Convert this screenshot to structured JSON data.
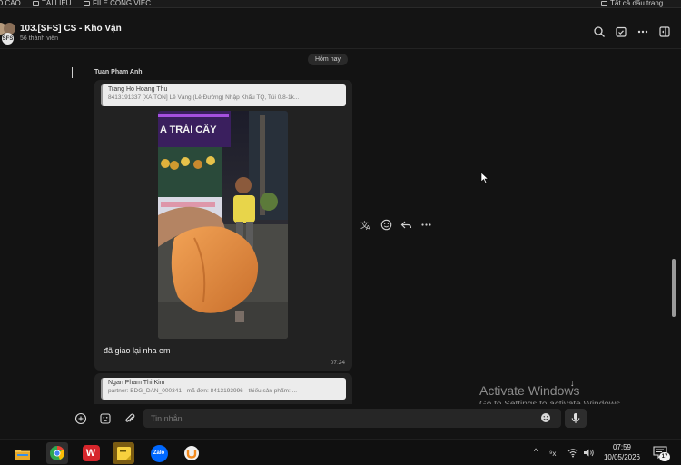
{
  "topbar": {
    "tabs": [
      "O CÁO",
      "TÀI LIỆU",
      "FILE CÔNG VIỆC"
    ],
    "right_label": "Tất cả dấu trang"
  },
  "header": {
    "title": "103.[SFS] CS - Kho Vận",
    "subtitle": "56 thành viên",
    "avatar_text": "SFS"
  },
  "chat": {
    "day_separator": "Hôm nay",
    "messages": [
      {
        "sender": "Tuan Pham Anh",
        "quote_name": "Trang Ho Hoang Thu",
        "quote_text": "8413191337 [XÀ TÔN] Lê Vàng (Lê Đường) Nhập Khẩu TQ, Túi 0.8-1k...",
        "image_sign_text": "A TRÁI CÂY",
        "text": "đã giao lại nha em",
        "time": "07:24"
      },
      {
        "quote_name": "Ngan Pham Thi Kim",
        "quote_text": "partner: BDG_DAN_000341 - mã đơn: 8413193996 - thiếu sản phẩm: ..."
      }
    ]
  },
  "watermark": {
    "line1": "Activate Windows",
    "line2": "Go to Settings to activate Windows."
  },
  "composer": {
    "placeholder": "Tin nhắn"
  },
  "taskbar": {
    "apps": [
      {
        "icon": "file-explorer-icon"
      },
      {
        "icon": "chrome-icon"
      },
      {
        "icon": "wps-office-icon",
        "label": "W"
      },
      {
        "icon": "sticky-notes-icon"
      },
      {
        "icon": "zalo-icon",
        "label": "Zalo"
      },
      {
        "icon": "ultraviewer-icon"
      }
    ],
    "time": "07:59",
    "date": "10/05/2026",
    "notifications": "17"
  },
  "colors": {
    "background": "#131313",
    "bubble": "#222222",
    "quote_bg": "#ececec",
    "wps_red": "#d7262c",
    "zalo_blue": "#0068ff"
  }
}
